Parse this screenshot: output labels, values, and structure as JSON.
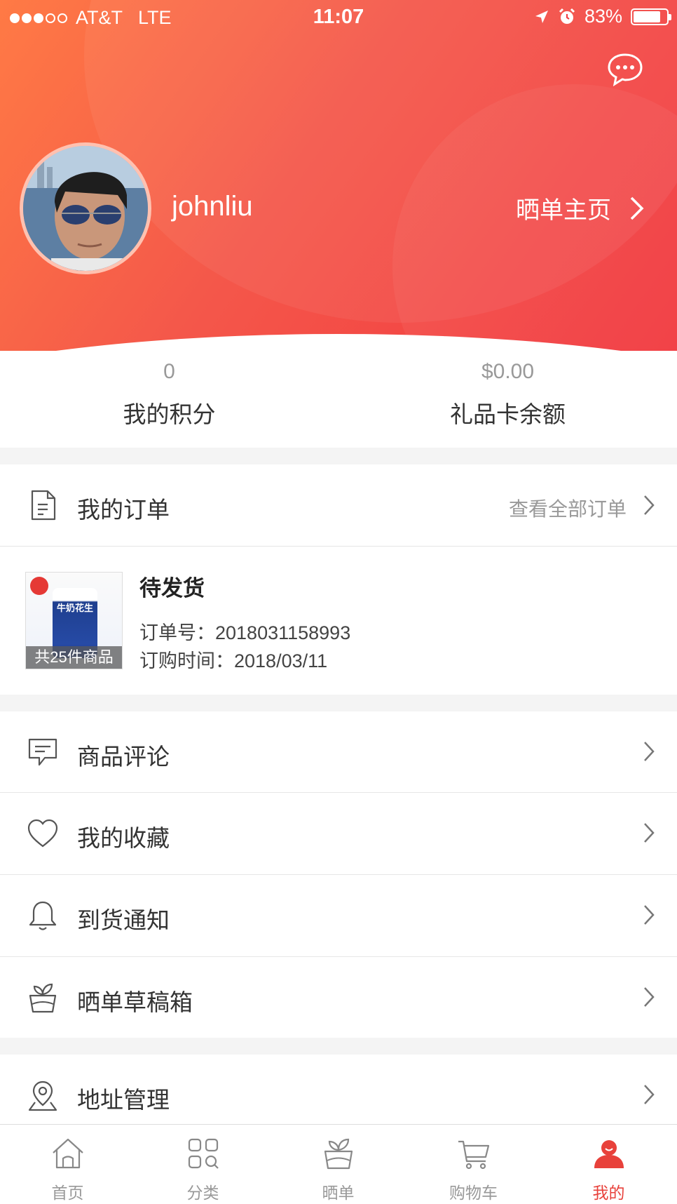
{
  "status_bar": {
    "carrier": "AT&T",
    "network": "LTE",
    "time": "11:07",
    "battery": "83%",
    "battery_level": 0.83
  },
  "profile": {
    "username": "johnliu",
    "homepage_label": "晒单主页"
  },
  "stats": {
    "points_value": "0",
    "points_label": "我的积分",
    "giftcard_value": "$0.00",
    "giftcard_label": "礼品卡余额"
  },
  "orders": {
    "title": "我的订单",
    "view_all": "查看全部订单",
    "latest": {
      "status": "待发货",
      "thumb_count": "共25件商品",
      "thumb_can_text": "牛奶花生",
      "order_no": "订单号：2018031158993",
      "order_time": "订购时间：2018/03/11"
    }
  },
  "menu": {
    "reviews": "商品评论",
    "favorites": "我的收藏",
    "arrival_notice": "到货通知",
    "drafts": "晒单草稿箱",
    "address": "地址管理"
  },
  "tabbar": {
    "home": "首页",
    "category": "分类",
    "showcase": "晒单",
    "cart": "购物车",
    "mine": "我的"
  },
  "colors": {
    "accent": "#e8413b",
    "header_start": "#ff7a45",
    "header_end": "#f2383f"
  }
}
